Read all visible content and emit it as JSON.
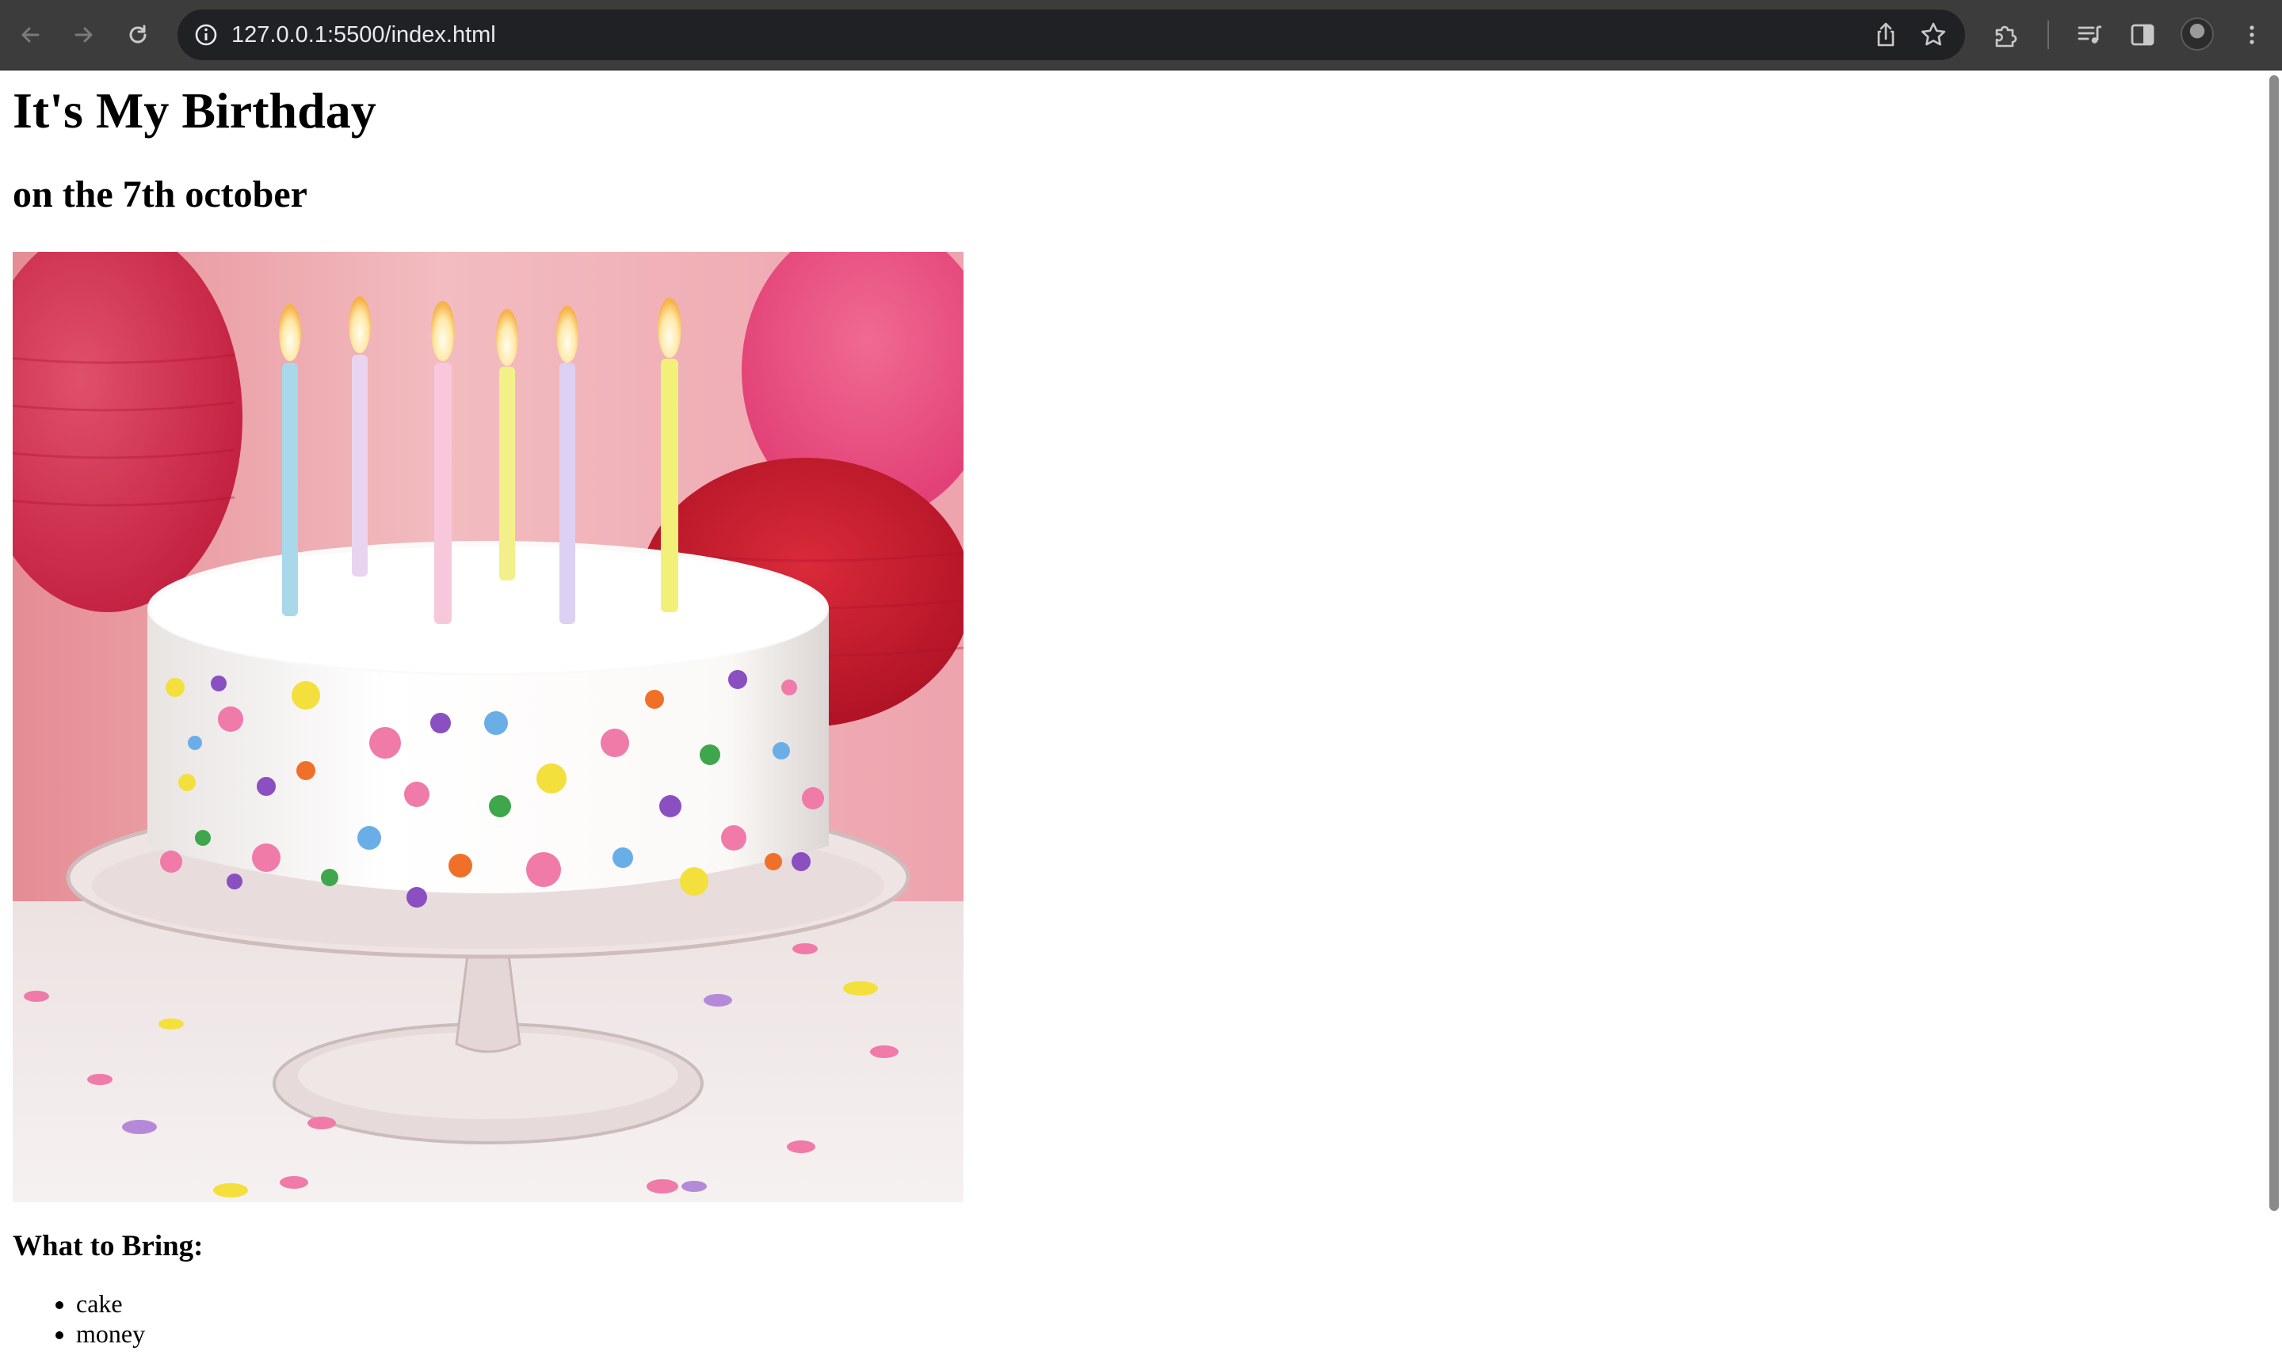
{
  "browser": {
    "url": "127.0.0.1:5500/index.html",
    "icons": [
      "back-arrow-icon",
      "forward-arrow-icon",
      "reload-icon",
      "site-info-icon",
      "share-icon",
      "bookmark-star-icon",
      "extensions-puzzle-icon",
      "media-controls-icon",
      "side-panel-icon",
      "profile-avatar",
      "kebab-menu-icon"
    ]
  },
  "page": {
    "heading": "It's My Birthday",
    "subheading": "on the 7th october",
    "image": {
      "subject": "birthday cake with six lit candles",
      "candle_colors": [
        "#a8d8ea",
        "#e8d4f0",
        "#f7c8dc",
        "#f3f08a",
        "#ddd0f2",
        "#f3f07a"
      ]
    },
    "list_title": "What to Bring:",
    "bring_items": [
      "cake",
      "money"
    ]
  }
}
